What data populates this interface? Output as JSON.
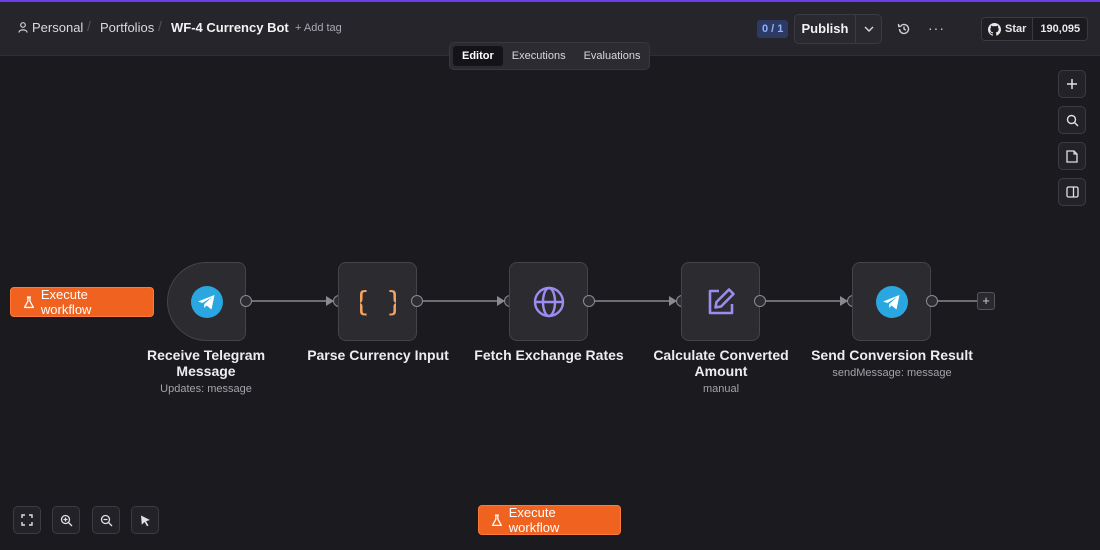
{
  "header": {
    "breadcrumb": {
      "personal": "Personal",
      "portfolios": "Portfolios",
      "separator": "/"
    },
    "workflow_title": "WF-4 Currency Bot",
    "add_tag": "+ Add tag",
    "version_counter": "0 / 1",
    "publish_label": "Publish",
    "more_label": "···",
    "github": {
      "star_label": "Star",
      "count": "190,095"
    }
  },
  "tabs": [
    {
      "label": "Editor",
      "active": true
    },
    {
      "label": "Executions",
      "active": false
    },
    {
      "label": "Evaluations",
      "active": false
    }
  ],
  "execute_label": "Execute workflow",
  "nodes": [
    {
      "label": "Receive Telegram Message",
      "sub": "Updates: message",
      "icon": "telegram-icon"
    },
    {
      "label": "Parse Currency Input",
      "sub": "",
      "icon": "code-braces-icon"
    },
    {
      "label": "Fetch Exchange Rates",
      "sub": "",
      "icon": "globe-icon"
    },
    {
      "label": "Calculate Converted Amount",
      "sub": "manual",
      "icon": "edit-icon"
    },
    {
      "label": "Send Conversion Result",
      "sub": "sendMessage: message",
      "icon": "telegram-icon"
    }
  ],
  "add_node_label": "+",
  "colors": {
    "accent_orange": "#f0621f",
    "telegram_blue": "#2aa7e0",
    "braces_orange": "#f4a261",
    "globe_purple": "#9b8cf0",
    "edit_purple": "#9b8cf0",
    "header_purple_line": "#6d3ee8"
  },
  "right_toolbar": [
    "zoom-in-icon",
    "search-icon",
    "sticky-note-icon",
    "panel-toggle-icon"
  ],
  "bottom_toolbar": [
    "fit-view-icon",
    "zoom-in-icon",
    "zoom-out-icon",
    "pointer-icon"
  ]
}
